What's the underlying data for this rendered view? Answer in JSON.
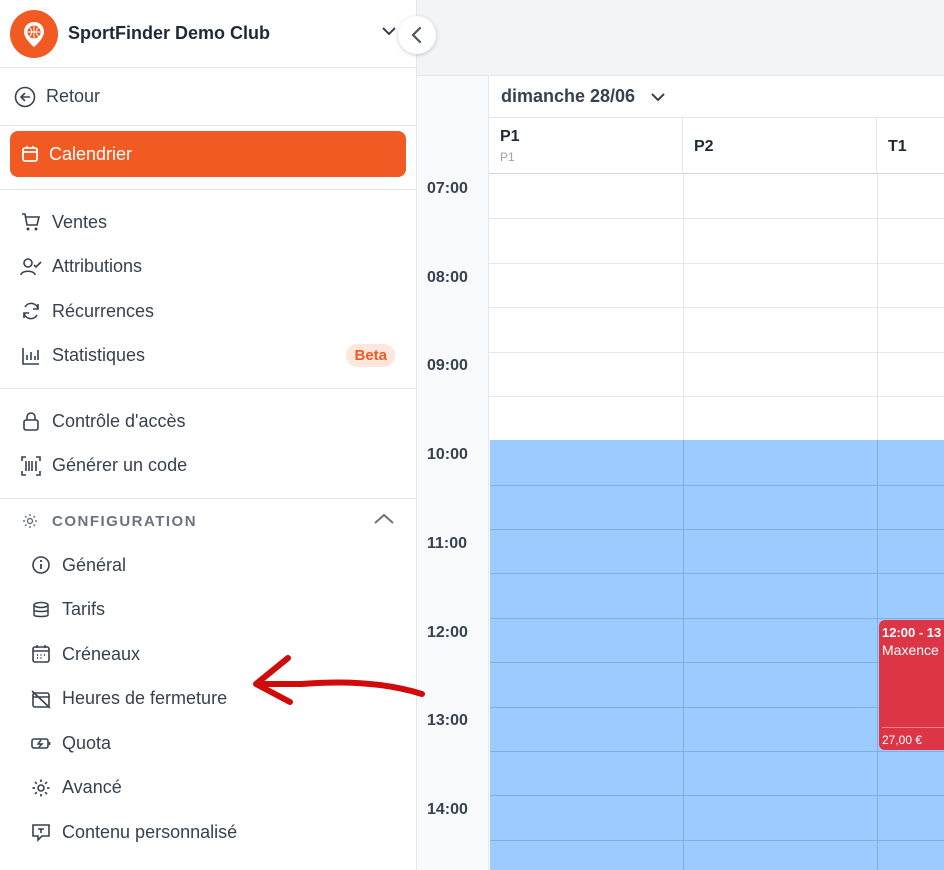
{
  "club": {
    "name": "SportFinder Demo Club"
  },
  "back": {
    "label": "Retour"
  },
  "nav": {
    "calendar": "Calendrier",
    "ventes": "Ventes",
    "attributions": "Attributions",
    "recurrences": "Récurrences",
    "statistiques": "Statistiques",
    "beta": "Beta",
    "controle": "Contrôle d'accès",
    "generer": "Générer un code"
  },
  "config": {
    "title": "CONFIGURATION",
    "items": {
      "general": "Général",
      "tarifs": "Tarifs",
      "creneaux": "Créneaux",
      "fermeture": "Heures de fermeture",
      "quota": "Quota",
      "avance": "Avancé",
      "contenu": "Contenu personnalisé"
    }
  },
  "calendar": {
    "date": "dimanche 28/06",
    "courts": [
      {
        "name": "P1",
        "sub": "P1"
      },
      {
        "name": "P2",
        "sub": ""
      },
      {
        "name": "T1",
        "sub": ""
      }
    ],
    "hours": [
      "07:00",
      "08:00",
      "09:00",
      "10:00",
      "11:00",
      "12:00",
      "13:00",
      "14:00"
    ],
    "booking": {
      "time": "12:00 - 13",
      "name": "Maxence",
      "price": "27,00 €"
    }
  },
  "colors": {
    "accent": "#f15a22",
    "closed": "#9ccbff",
    "booking": "#dc3545",
    "annotation": "#d10a0a"
  }
}
